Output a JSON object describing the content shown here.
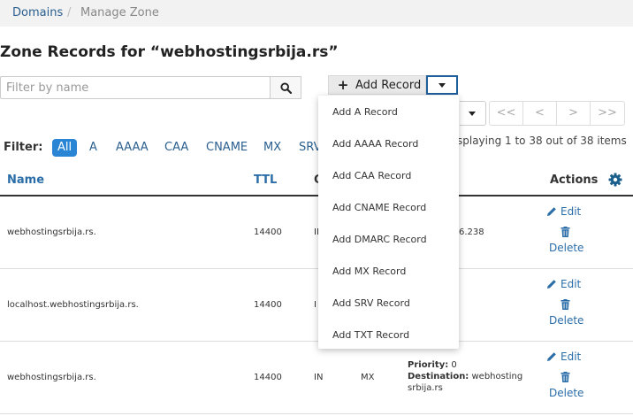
{
  "breadcrumb": {
    "link": "Domains",
    "separator": "/",
    "current": "Manage Zone"
  },
  "title": "Zone Records for “webhostingsrbija.rs”",
  "search": {
    "placeholder": "Filter by name",
    "value": ""
  },
  "add_button_label": "Add Record",
  "add_menu": [
    "Add A Record",
    "Add AAAA Record",
    "Add CAA Record",
    "Add CNAME Record",
    "Add DMARC Record",
    "Add MX Record",
    "Add SRV Record",
    "Add TXT Record"
  ],
  "pager": {
    "first": "<<",
    "prev": "<",
    "next": ">",
    "last": ">>"
  },
  "filter": {
    "label": "Filter:",
    "options": [
      "All",
      "A",
      "AAAA",
      "CAA",
      "CNAME",
      "MX",
      "SRV"
    ]
  },
  "count_text": "splaying 1 to 38 out of 38 items",
  "columns": {
    "name": "Name",
    "ttl": "TTL",
    "class_partial": "C",
    "actions": "Actions"
  },
  "rows": [
    {
      "name": "webhostingsrbija.rs.",
      "ttl": "14400",
      "class": "IN",
      "type": "",
      "value_partial": "6.238"
    },
    {
      "name": "localhost.webhostingsrbija.rs.",
      "ttl": "14400",
      "class": "I",
      "type": "",
      "value_partial": ""
    },
    {
      "name": "webhostingsrbija.rs.",
      "ttl": "14400",
      "class": "IN",
      "type": "MX",
      "priority_label": "Priority:",
      "priority_value": "0",
      "destination_label": "Destination:",
      "destination_value_1": "webhosting",
      "destination_value_2": "srbija.rs"
    }
  ],
  "actions": {
    "edit": "Edit",
    "delete": "Delete"
  },
  "colors": {
    "link": "#2a6da8",
    "accent": "#2a86d4",
    "focus_border": "#1f5f9c"
  }
}
